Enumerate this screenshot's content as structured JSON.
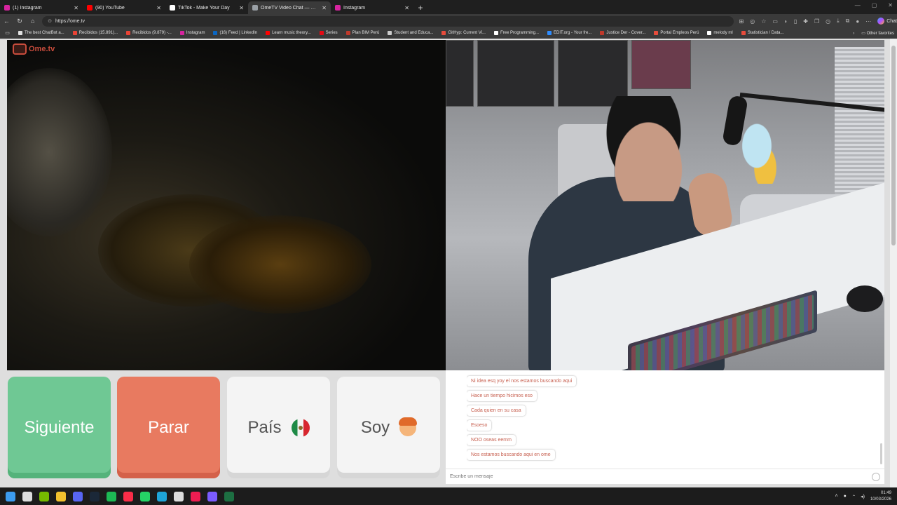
{
  "browser": {
    "tabs": [
      {
        "label": "(1) Instagram",
        "favicon_color": "#d6249f",
        "active": false
      },
      {
        "label": "(90) YouTube",
        "favicon_color": "#ff0000",
        "active": false
      },
      {
        "label": "TikTok - Make Your Day",
        "favicon_color": "#ffffff",
        "active": false
      },
      {
        "label": "OmeTV Video Chat — Omeg",
        "favicon_color": "#9aa0a6",
        "active": true
      },
      {
        "label": "Instagram",
        "favicon_color": "#d6249f",
        "active": false
      }
    ],
    "new_tab_glyph": "+",
    "url": "https://ome.tv",
    "chat_label": "Chat",
    "bookmarks": [
      {
        "label": "The best ChatBot a...",
        "color": "#e0e0e0"
      },
      {
        "label": "Recibidos (15.891)...",
        "color": "#ea4335"
      },
      {
        "label": "Recibidos (9.879) -...",
        "color": "#ea4335"
      },
      {
        "label": "Instagram",
        "color": "#d6249f"
      },
      {
        "label": "(16) Feed | LinkedIn",
        "color": "#0a66c2"
      },
      {
        "label": "Learn music theory...",
        "color": "#ff0000"
      },
      {
        "label": "Series",
        "color": "#e50914"
      },
      {
        "label": "Plan BIM Perú",
        "color": "#c0392b"
      },
      {
        "label": "Student and Educa...",
        "color": "#cccccc"
      },
      {
        "label": "GitHyp: Current Vi...",
        "color": "#e74c3c"
      },
      {
        "label": "Free Programming...",
        "color": "#ffffff"
      },
      {
        "label": "EDIT.org - Your fre...",
        "color": "#2d8cff"
      },
      {
        "label": "Justice Der - Cover...",
        "color": "#c0392b"
      },
      {
        "label": "Portal Empleos Perú",
        "color": "#e74c3c"
      },
      {
        "label": "melody ml",
        "color": "#ffffff"
      },
      {
        "label": "Statistician / Data...",
        "color": "#e74c3c"
      }
    ],
    "other_favorites": "Other favorites"
  },
  "ometv": {
    "logo_text": "Ome.tv",
    "buttons": {
      "next": "Siguiente",
      "stop": "Parar",
      "country": "País",
      "gender": "Soy"
    },
    "messages": [
      "Ni idea esq yoy el nos estamos buscando aqui",
      "Hace un tiempo hicimos eso",
      "Cada quien en su casa",
      "Esoeso",
      "NOO oseas eemm",
      "Nos estamos buscando aqui en ome"
    ],
    "input_placeholder": "Escribe un mensaje"
  },
  "taskbar": {
    "icons": [
      {
        "name": "windows-start-icon",
        "color": "#3c9cf0"
      },
      {
        "name": "search-icon",
        "color": "#dddddd"
      },
      {
        "name": "nvidia-icon",
        "color": "#76b900"
      },
      {
        "name": "file-explorer-icon",
        "color": "#f2c12e"
      },
      {
        "name": "discord-icon",
        "color": "#5865f2"
      },
      {
        "name": "steam-icon",
        "color": "#1b2838"
      },
      {
        "name": "spotify-icon",
        "color": "#1db954"
      },
      {
        "name": "apple-music-icon",
        "color": "#fa2d48"
      },
      {
        "name": "whatsapp-icon",
        "color": "#25d366"
      },
      {
        "name": "edge-icon",
        "color": "#1ea5d8"
      },
      {
        "name": "chrome-icon",
        "color": "#dddddd"
      },
      {
        "name": "tiktok-icon",
        "color": "#ee1d52"
      },
      {
        "name": "obs-icon",
        "color": "#7b5cff"
      },
      {
        "name": "excel-icon",
        "color": "#1d6f42"
      }
    ],
    "time": "01:49",
    "date": "10/03/2026"
  }
}
